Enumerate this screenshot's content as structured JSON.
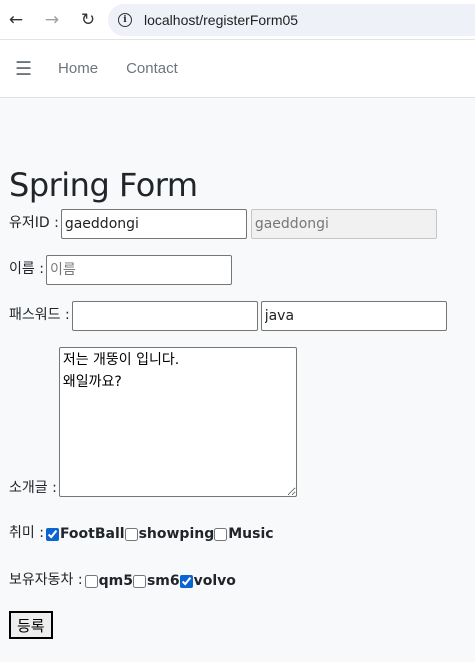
{
  "browser": {
    "url": "localhost/registerForm05"
  },
  "nav": {
    "home": "Home",
    "contact": "Contact"
  },
  "form": {
    "title": "Spring Form",
    "userId": {
      "label": "유저ID :",
      "value": "gaeddongi",
      "readonly_value": "gaeddongi"
    },
    "name": {
      "label": "이름 :",
      "placeholder": "이름",
      "value": ""
    },
    "password": {
      "label": "패스워드 :",
      "value": "",
      "plain_value": "java"
    },
    "intro": {
      "label": "소개글 :",
      "value": "저는 개뚱이 입니다.\n왜일까요?"
    },
    "hobby": {
      "label": "취미 :",
      "options": [
        {
          "label": "FootBall",
          "checked": true
        },
        {
          "label": "showping",
          "checked": false
        },
        {
          "label": "Music",
          "checked": false
        }
      ]
    },
    "cars": {
      "label": "보유자동차 :",
      "options": [
        {
          "label": "qm5",
          "checked": false
        },
        {
          "label": "sm6",
          "checked": false
        },
        {
          "label": "volvo",
          "checked": true
        }
      ]
    },
    "submit_label": "등록"
  }
}
